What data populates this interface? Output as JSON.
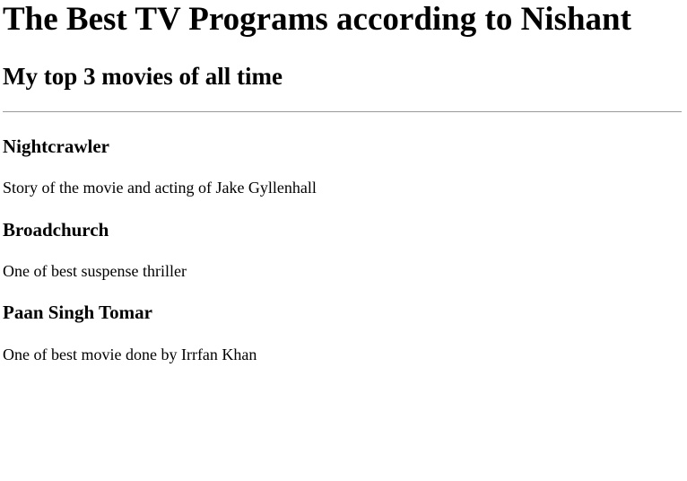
{
  "page": {
    "title": "The Best TV Programs according to Nishant",
    "subtitle": "My top 3 movies of all time"
  },
  "items": [
    {
      "name": "Nightcrawler",
      "description": "Story of the movie and acting of Jake Gyllenhall"
    },
    {
      "name": "Broadchurch",
      "description": "One of best suspense thriller"
    },
    {
      "name": "Paan Singh Tomar",
      "description": "One of best movie done by Irrfan Khan"
    }
  ]
}
